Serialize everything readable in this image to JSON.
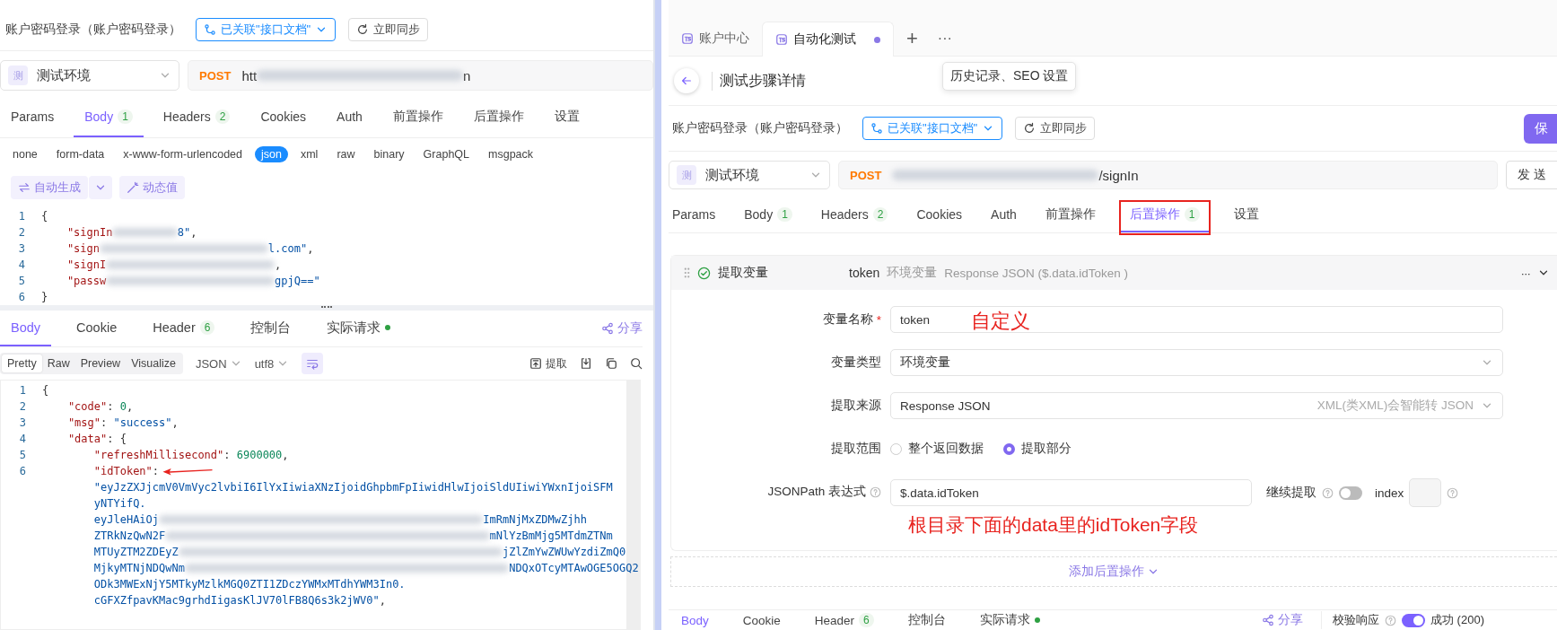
{
  "left_panel": {
    "api_bar": {
      "title": "账户密码登录（账户密码登录）",
      "link_button": "已关联\"接口文档\"",
      "sync_button": "立即同步"
    },
    "environment": {
      "badge": "测",
      "name": "测试环境"
    },
    "url": {
      "method": "POST",
      "visible_start": "htt",
      "visible_end": "n"
    },
    "tabs": [
      {
        "label": "Params",
        "selected": false
      },
      {
        "label": "Body",
        "count": "1",
        "selected": true
      },
      {
        "label": "Headers",
        "count": "2",
        "selected": false
      },
      {
        "label": "Cookies",
        "selected": false
      },
      {
        "label": "Auth",
        "selected": false
      },
      {
        "label": "前置操作",
        "selected": false
      },
      {
        "label": "后置操作",
        "selected": false
      },
      {
        "label": "设置",
        "selected": false
      }
    ],
    "body_types": [
      {
        "label": "none",
        "selected": false
      },
      {
        "label": "form-data",
        "selected": false
      },
      {
        "label": "x-www-form-urlencoded",
        "selected": false
      },
      {
        "label": "json",
        "selected": true
      },
      {
        "label": "xml",
        "selected": false
      },
      {
        "label": "raw",
        "selected": false
      },
      {
        "label": "binary",
        "selected": false
      },
      {
        "label": "GraphQL",
        "selected": false
      },
      {
        "label": "msgpack",
        "selected": false
      }
    ],
    "editor_tools": [
      {
        "label": "自动生成",
        "kind": "split"
      },
      {
        "label": "动态值",
        "kind": "plain"
      }
    ],
    "request_code": [
      {
        "number": "1",
        "parts": [
          {
            "kind": "punct",
            "text": "{"
          }
        ]
      },
      {
        "number": "2",
        "parts": [
          {
            "kind": "key",
            "text": "    \"signIn"
          },
          {
            "kind": "blur"
          },
          {
            "kind": "str",
            "text": "8\""
          },
          {
            "kind": "punct",
            "text": ","
          }
        ]
      },
      {
        "number": "3",
        "parts": [
          {
            "kind": "key",
            "text": "    \"sign"
          },
          {
            "kind": "blur_wide"
          },
          {
            "kind": "str",
            "text": "l.com\""
          },
          {
            "kind": "punct",
            "text": ","
          }
        ]
      },
      {
        "number": "4",
        "parts": [
          {
            "kind": "key",
            "text": "    \"signI"
          },
          {
            "kind": "blur_wide"
          },
          {
            "kind": "punct",
            "text": ","
          }
        ]
      },
      {
        "number": "5",
        "parts": [
          {
            "kind": "key",
            "text": "    \"passw"
          },
          {
            "kind": "blur_wide"
          },
          {
            "kind": "str",
            "text": "gpjQ==\""
          }
        ]
      },
      {
        "number": "6",
        "parts": [
          {
            "kind": "punct",
            "text": "}"
          }
        ]
      }
    ],
    "response_tabs": [
      {
        "label": "Body",
        "selected": true
      },
      {
        "label": "Cookie",
        "selected": false
      },
      {
        "label": "Header",
        "count": "6",
        "selected": false
      },
      {
        "label": "控制台",
        "selected": false
      },
      {
        "label": "实际请求",
        "dot": true,
        "selected": false
      }
    ],
    "share": "分享",
    "view_modes": [
      {
        "label": "Pretty",
        "selected": true
      },
      {
        "label": "Raw",
        "selected": false
      },
      {
        "label": "Preview",
        "selected": false
      },
      {
        "label": "Visualize",
        "selected": false
      }
    ],
    "format_selects": [
      "JSON",
      "utf8"
    ],
    "wrap": {
      "on": true
    },
    "extract_button": "提取",
    "response_code": [
      {
        "number": "1",
        "parts": [
          {
            "kind": "punct",
            "text": "{"
          }
        ]
      },
      {
        "number": "2",
        "parts": [
          {
            "kind": "key",
            "text": "    \"code\""
          },
          {
            "kind": "punct",
            "text": ": "
          },
          {
            "kind": "num",
            "text": "0"
          },
          {
            "kind": "punct",
            "text": ","
          }
        ]
      },
      {
        "number": "3",
        "parts": [
          {
            "kind": "key",
            "text": "    \"msg\""
          },
          {
            "kind": "punct",
            "text": ": "
          },
          {
            "kind": "str",
            "text": "\"success\""
          },
          {
            "kind": "punct",
            "text": ","
          }
        ]
      },
      {
        "number": "4",
        "parts": [
          {
            "kind": "key",
            "text": "    \"data\""
          },
          {
            "kind": "punct",
            "text": ": {"
          }
        ]
      },
      {
        "number": "5",
        "parts": [
          {
            "kind": "key",
            "text": "        \"refreshMillisecond\""
          },
          {
            "kind": "punct",
            "text": ": "
          },
          {
            "kind": "num",
            "text": "6900000"
          },
          {
            "kind": "punct",
            "text": ","
          }
        ]
      },
      {
        "number": "6",
        "parts": [
          {
            "kind": "key",
            "text": "        \"idToken\""
          },
          {
            "kind": "punct",
            "text": ":"
          },
          {
            "kind": "arrow"
          }
        ]
      },
      {
        "parts": [
          {
            "kind": "str",
            "text": "        \"eyJzZXJjcmV0VmVyc2lvbiI6IlYxIiwiaXNzIjoidGhpbmFpIiwidHlwIjoiSldUIiwiYWxnIjoiSFM"
          }
        ]
      },
      {
        "parts": [
          {
            "kind": "str",
            "text": "        yNTYifQ."
          }
        ]
      },
      {
        "parts": [
          {
            "kind": "str",
            "text": "        eyJleHAiOj"
          },
          {
            "kind": "blur_long"
          },
          {
            "kind": "str",
            "text": "ImRmNjMxZDMwZjhh"
          }
        ]
      },
      {
        "parts": [
          {
            "kind": "str",
            "text": "        ZTRkNzQwN2F"
          },
          {
            "kind": "blur_long"
          },
          {
            "kind": "str",
            "text": "mNlYzBmMjg5MTdmZTNm"
          }
        ]
      },
      {
        "parts": [
          {
            "kind": "str",
            "text": "        MTUyZTM2ZDEyZ"
          },
          {
            "kind": "blur_long"
          },
          {
            "kind": "str",
            "text": "jZlZmYwZWUwYzdiZmQ0"
          }
        ]
      },
      {
        "parts": [
          {
            "kind": "str",
            "text": "        MjkyMTNjNDQwNm"
          },
          {
            "kind": "blur_long"
          },
          {
            "kind": "str",
            "text": "NDQxOTcyMTAwOGE5OGQ2"
          }
        ]
      },
      {
        "parts": [
          {
            "kind": "str",
            "text": "        ODk3MWExNjY5MTkyMzlkMGQ0ZTI1ZDczYWMxMTdhYWM3In0."
          }
        ]
      },
      {
        "parts": [
          {
            "kind": "str",
            "text": "        cGFXZfpavKMac9grhdIigasKlJV70lFB8Q6s3k2jWV0\""
          },
          {
            "kind": "punct",
            "text": ","
          }
        ]
      }
    ]
  },
  "right_panel": {
    "file_tabs": [
      {
        "label": "账户中心",
        "selected": false,
        "unsaved": false
      },
      {
        "label": "自动化测试",
        "selected": true,
        "unsaved": true
      }
    ],
    "new_tab": "+",
    "more_tabs": "···",
    "page_title": "测试步骤详情",
    "tooltip": "历史记录、SEO 设置",
    "api_bar": {
      "title": "账户密码登录（账户密码登录）",
      "link_button": "已关联\"接口文档\"",
      "sync_button": "立即同步"
    },
    "save_button": "保",
    "environment": {
      "badge": "测",
      "name": "测试环境"
    },
    "url": {
      "method": "POST",
      "visible_end": "/signIn"
    },
    "send_button": "发 送",
    "tabs": [
      {
        "label": "Params",
        "selected": false
      },
      {
        "label": "Body",
        "count": "1",
        "selected": false
      },
      {
        "label": "Headers",
        "count": "2",
        "selected": false
      },
      {
        "label": "Cookies",
        "selected": false
      },
      {
        "label": "Auth",
        "selected": false
      },
      {
        "label": "前置操作",
        "selected": false
      },
      {
        "label": "后置操作",
        "count": "1",
        "selected": true,
        "boxed": true
      },
      {
        "label": "设置",
        "selected": false
      }
    ],
    "post_operation": {
      "enabled": true,
      "title": "提取变量",
      "variable": "token",
      "scope": "环境变量",
      "summary": "Response JSON ($.data.idToken )",
      "more": "···",
      "fields": [
        {
          "kind": "text",
          "label": "变量名称",
          "required_mark": "*",
          "value": "token",
          "note": "自定义"
        },
        {
          "kind": "select",
          "label": "变量类型",
          "value": "环境变量"
        },
        {
          "kind": "select",
          "label": "提取来源",
          "value": "Response JSON",
          "hint": "XML(类XML)会智能转 JSON"
        },
        {
          "kind": "radio",
          "label": "提取范围",
          "options": [
            {
              "label": "整个返回数据",
              "selected": false
            },
            {
              "label": "提取部分",
              "selected": true
            }
          ]
        },
        {
          "kind": "jsonpath",
          "label": "JSONPath 表达式",
          "value": "$.data.idToken",
          "continue_label": "继续提取",
          "continue_on": false,
          "index_label": "index",
          "note": "根目录下面的data里的idToken字段"
        }
      ]
    },
    "add_button": "添加后置操作",
    "response_tabs": [
      {
        "label": "Body",
        "selected": true
      },
      {
        "label": "Cookie",
        "selected": false
      },
      {
        "label": "Header",
        "count": "6",
        "selected": false
      },
      {
        "label": "控制台",
        "selected": false
      },
      {
        "label": "实际请求",
        "dot": true,
        "selected": false
      }
    ],
    "share": "分享",
    "validation": {
      "label": "校验响应",
      "on": true,
      "result": "成功 (200)"
    }
  }
}
